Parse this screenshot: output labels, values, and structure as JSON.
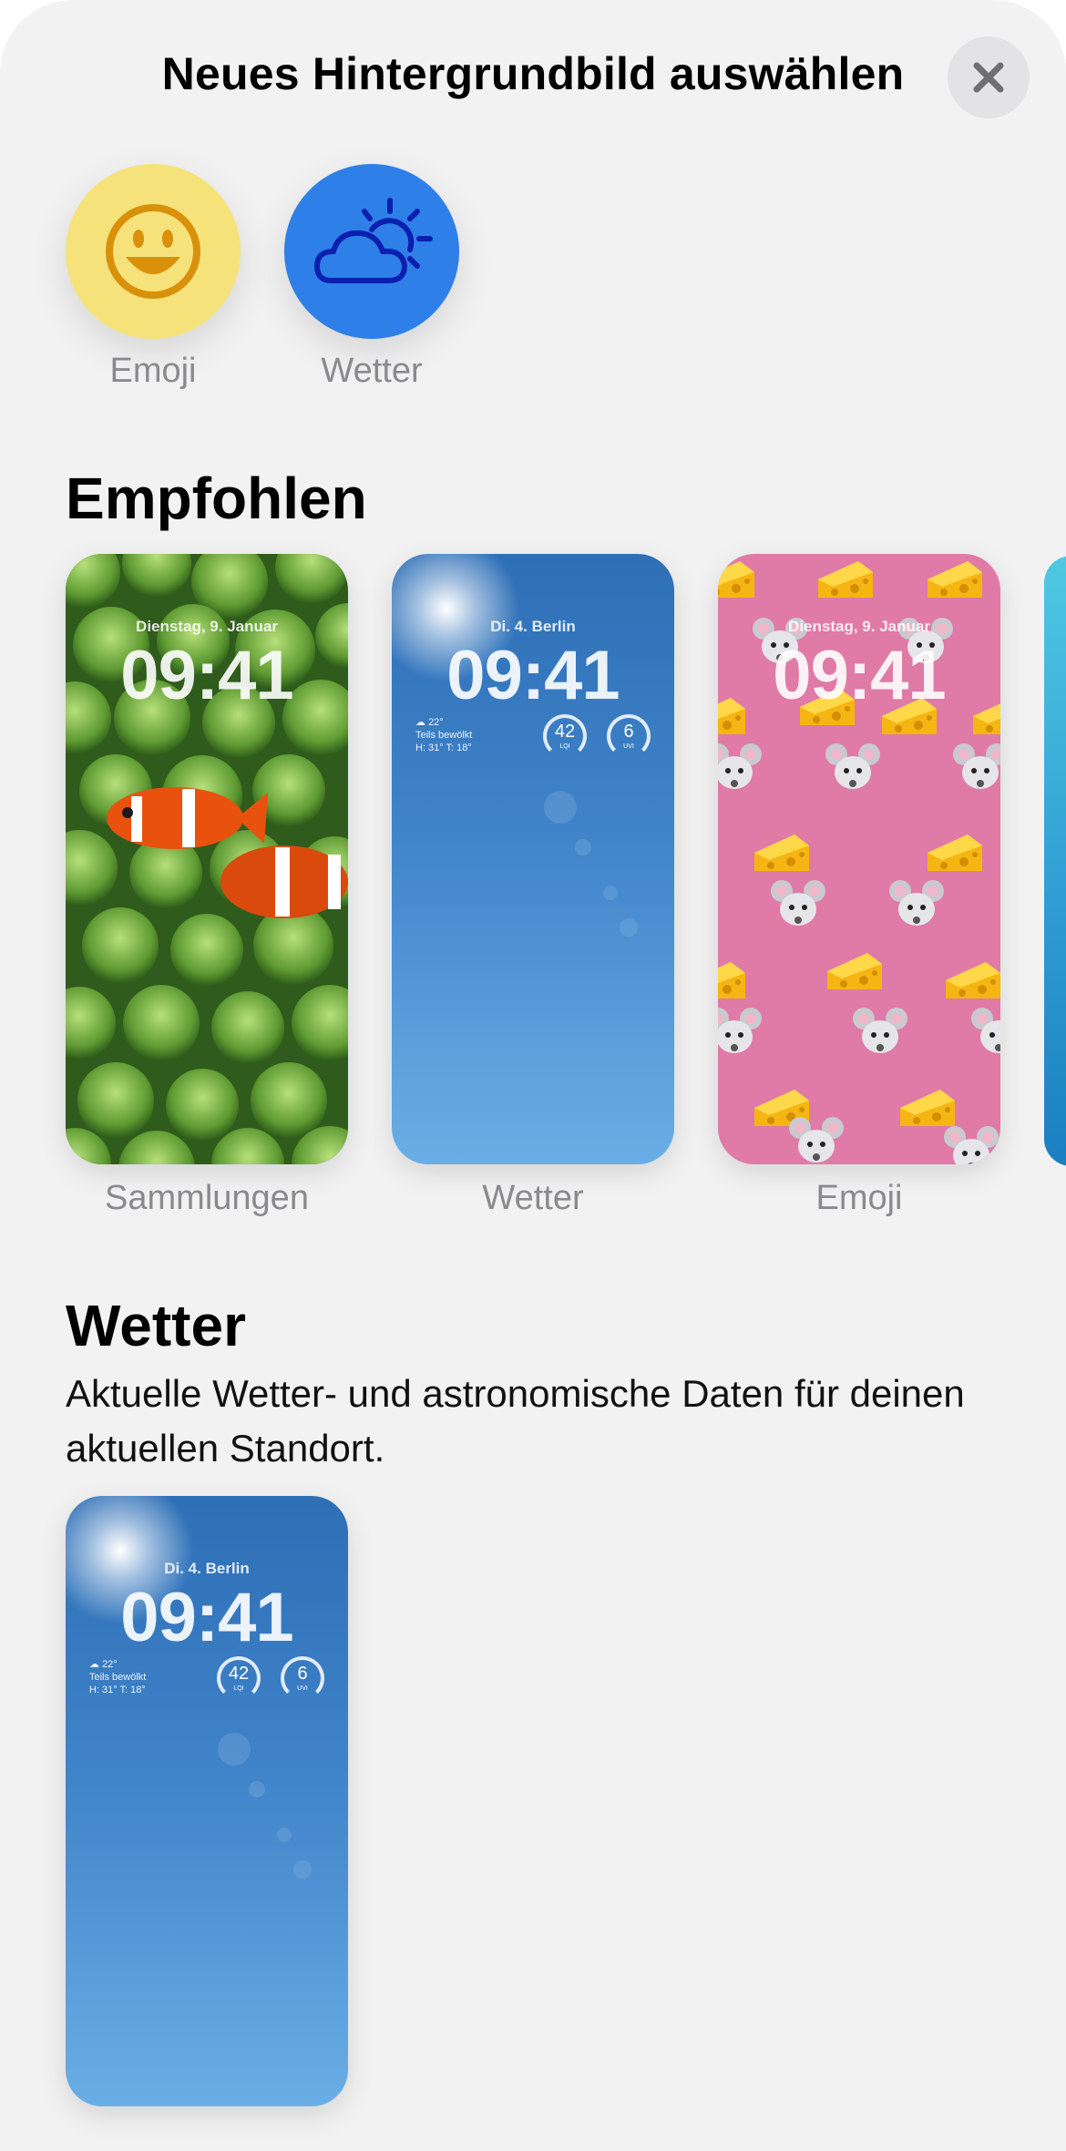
{
  "header": {
    "title": "Neues Hintergrundbild auswählen"
  },
  "categories": [
    {
      "label": "Emoji",
      "icon": "smiley-icon",
      "color": "#f7e07b"
    },
    {
      "label": "Wetter",
      "icon": "weather-cloud-sun-icon",
      "color": "#2f7fe8"
    }
  ],
  "recommended": {
    "title": "Empfohlen",
    "cards": [
      {
        "label": "Sammlungen",
        "date": "Dienstag, 9. Januar",
        "time": "09:41"
      },
      {
        "label": "Wetter",
        "date": "Di. 4.  Berlin",
        "time": "09:41",
        "temp": "22°",
        "condition": "Teils bewölkt",
        "hilo": "H: 31° T: 18°",
        "aqi": "42",
        "aqi_label": "LQI",
        "uvi": "6",
        "uvi_label": "UVI"
      },
      {
        "label": "Emoji",
        "date": "Dienstag, 9. Januar",
        "time": "09:41"
      }
    ]
  },
  "weather_section": {
    "title": "Wetter",
    "description": "Aktuelle Wetter- und astronomische Daten für deinen aktuellen Standort.",
    "card": {
      "date": "Di. 4.  Berlin",
      "time": "09:41",
      "temp": "22°",
      "condition": "Teils bewölkt",
      "hilo": "H: 31° T: 18°",
      "aqi": "42",
      "aqi_label": "LQI",
      "uvi": "6",
      "uvi_label": "UVI"
    }
  }
}
